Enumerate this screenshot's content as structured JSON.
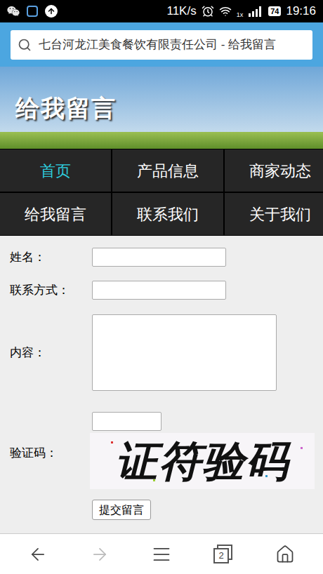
{
  "status_bar": {
    "net_speed": "11K/s",
    "network": "1x",
    "battery": "74",
    "time": "19:16"
  },
  "address_bar": {
    "text": "七台河龙江美食餐饮有限责任公司 - 给我留言"
  },
  "banner": {
    "title": "给我留言"
  },
  "nav": [
    {
      "label": "首页",
      "selected": true
    },
    {
      "label": "产品信息",
      "selected": false
    },
    {
      "label": "商家动态",
      "selected": false
    },
    {
      "label": "给我留言",
      "selected": false
    },
    {
      "label": "联系我们",
      "selected": false
    },
    {
      "label": "关于我们",
      "selected": false
    }
  ],
  "form": {
    "fields": [
      {
        "label": "姓名：",
        "kind": "input"
      },
      {
        "label": "联系方式：",
        "kind": "input"
      },
      {
        "label": "内容：",
        "kind": "textarea"
      }
    ],
    "captcha": {
      "label": "验证码：",
      "text": "证符验码"
    },
    "submit": "提交留言"
  },
  "toolbar": {
    "back_enabled": true,
    "forward_enabled": false,
    "tab_count": "2"
  }
}
